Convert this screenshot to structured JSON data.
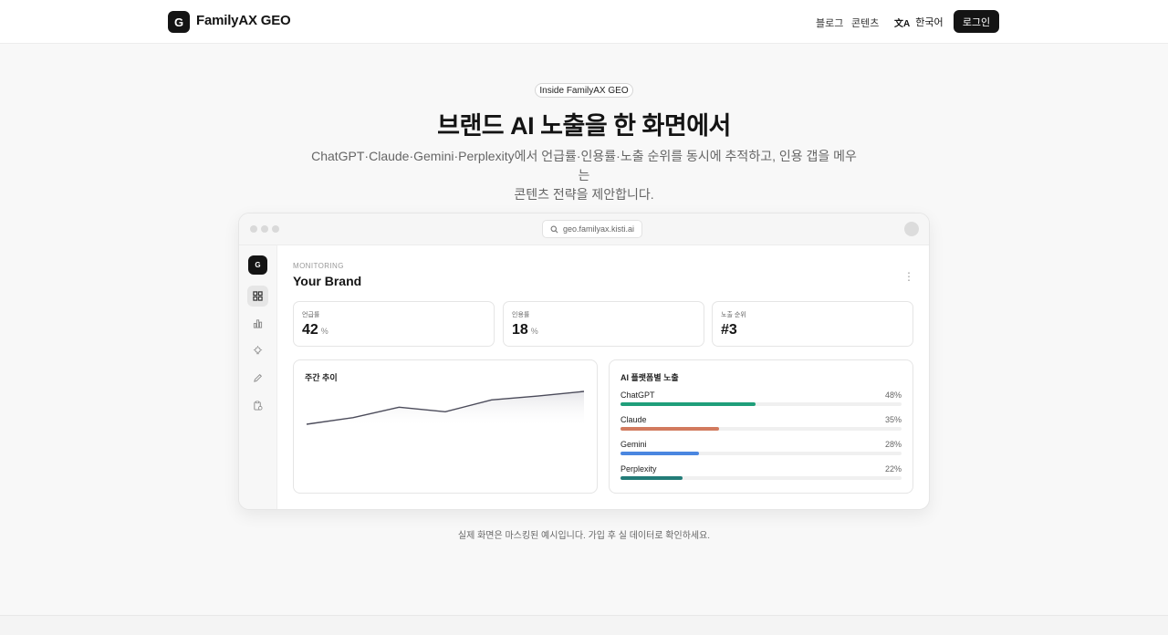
{
  "header": {
    "logo_letter": "G",
    "brand": "FamilyAX GEO",
    "nav": [
      {
        "label": "블로그"
      },
      {
        "label": "콘텐츠"
      }
    ],
    "language": "한국어",
    "language_icon": "translate-icon",
    "login": "로그인"
  },
  "hero": {
    "pill": "Inside FamilyAX GEO",
    "title": "브랜드 AI 노출을 한 화면에서",
    "subtitle_line1": "ChatGPT·Claude·Gemini·Perplexity에서 언급률·인용률·노출 순위를 동시에 추적하고, 인용 갭을 메우는",
    "subtitle_line2": "콘텐츠 전략을 제안합니다."
  },
  "mockup": {
    "url": "geo.familyax.kisti.ai",
    "app_logo": "G",
    "sidebar_icons": [
      "grid-icon",
      "bar-chart-icon",
      "lightbulb-icon",
      "pencil-icon",
      "clipboard-icon"
    ],
    "section_label": "MONITORING",
    "title": "Your Brand",
    "stats": [
      {
        "label": "언급률",
        "value": "42",
        "unit": "%"
      },
      {
        "label": "인용률",
        "value": "18",
        "unit": "%"
      },
      {
        "label": "노출 순위",
        "value": "#3",
        "unit": ""
      }
    ],
    "trend_title": "주간 추이",
    "trend_values": [
      1.0,
      2.0,
      3.6,
      2.9,
      4.7,
      5.3,
      6.0
    ],
    "platform_title": "AI 플랫폼별 노출",
    "platforms": [
      {
        "name": "ChatGPT",
        "pct_label": "48%",
        "value": 48,
        "color": "#1f9e7a"
      },
      {
        "name": "Claude",
        "pct_label": "35%",
        "value": 35,
        "color": "#d27a5e"
      },
      {
        "name": "Gemini",
        "pct_label": "28%",
        "value": 28,
        "color": "#4a86e0"
      },
      {
        "name": "Perplexity",
        "pct_label": "22%",
        "value": 22,
        "color": "#237c78"
      }
    ]
  },
  "caption": "실제 화면은 마스킹된 예시입니다. 가입 후 실 데이터로 확인하세요."
}
